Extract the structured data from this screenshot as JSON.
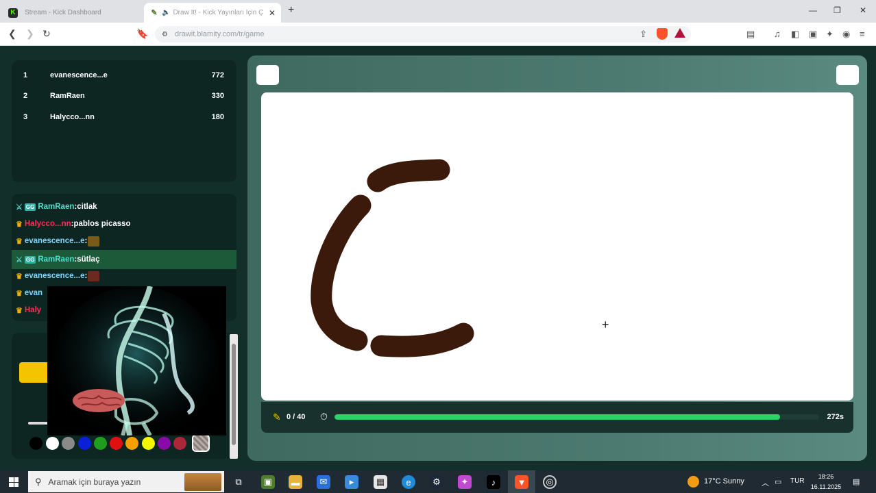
{
  "browser": {
    "tabs": [
      {
        "title": "Stream - Kick Dashboard",
        "active": false
      },
      {
        "title": "Draw It! - Kick Yayınları İçin Ç",
        "active": true
      }
    ],
    "url": "drawit.blamity.com/tr/game"
  },
  "leaderboard": [
    {
      "rank": "1",
      "name": "evanescence...e",
      "score": "772"
    },
    {
      "rank": "2",
      "name": "RamRaen",
      "score": "330"
    },
    {
      "rank": "3",
      "name": "Halycco...nn",
      "score": "180"
    }
  ],
  "chat": [
    {
      "user": "RamRaen",
      "sep": ":",
      "msg": "citlak",
      "badge": "mod"
    },
    {
      "user": "Halycco...nn",
      "sep": ":",
      "msg": "pablos picasso",
      "badge": "crown",
      "user_color": "red"
    },
    {
      "user": "evanescence...e",
      "sep": ":",
      "msg": "",
      "badge": "crown",
      "sticker": "#7a5a18"
    },
    {
      "user": "RamRaen",
      "sep": ":",
      "msg": "sütlaç",
      "badge": "mod",
      "highlight": true
    },
    {
      "user": "evanescence...e",
      "sep": ":",
      "msg": "",
      "badge": "crown",
      "sticker": "#6a2a20"
    },
    {
      "user": "evan",
      "sep": "",
      "msg": "",
      "badge": "crown"
    },
    {
      "user": "Haly",
      "sep": "",
      "msg": "",
      "badge": "crown",
      "user_color": "red"
    }
  ],
  "palette": [
    "#000000",
    "#ffffff",
    "#8a8a8a",
    "#0a1fd8",
    "#1f9d1f",
    "#e01010",
    "#f5a000",
    "#f5f500",
    "#8a0aa8",
    "#a8283a"
  ],
  "game": {
    "count": "0 / 40",
    "time": "272s",
    "progress": 0.92,
    "pencil_icon": "pencil-icon",
    "timer_icon": "stopwatch-icon",
    "brush_color": "#3b1a0c"
  },
  "taskbar": {
    "search_placeholder": "Aramak için buraya yazın",
    "weather": "17°C  Sunny",
    "lang": "TUR",
    "time": "18:26",
    "date": "16.11.2025"
  }
}
